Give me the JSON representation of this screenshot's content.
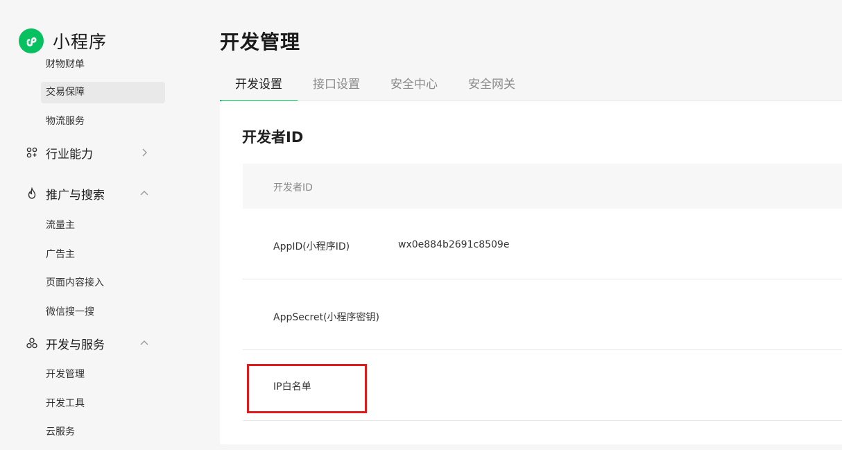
{
  "sidebar": {
    "brand": "小程序",
    "clipped_item": "财物财单",
    "items_top": [
      "交易保障",
      "物流服务"
    ],
    "group_industry": "行业能力",
    "group_promo": "推广与搜索",
    "promo_items": [
      "流量主",
      "广告主",
      "页面内容接入",
      "微信搜一搜"
    ],
    "group_dev": "开发与服务",
    "dev_items": [
      "开发管理",
      "开发工具",
      "云服务"
    ]
  },
  "main": {
    "title": "开发管理",
    "tabs": [
      "开发设置",
      "接口设置",
      "安全中心",
      "安全网关"
    ],
    "section_title": "开发者ID",
    "table_header": "开发者ID",
    "rows": [
      {
        "label": "AppID(小程序ID)",
        "value": "wx0e884b2691c8509e"
      },
      {
        "label": "AppSecret(小程序密钥)",
        "value": ""
      },
      {
        "label": "IP白名单",
        "value": ""
      }
    ]
  },
  "colors": {
    "accent": "#07c160",
    "highlight": "#e01b1b"
  },
  "icons": {
    "brand": "mini-program-logo-icon",
    "industry": "industry-icon",
    "promo": "flame-icon",
    "dev": "dev-service-icon",
    "expand": "chevron-right-icon",
    "collapse": "chevron-up-icon"
  }
}
